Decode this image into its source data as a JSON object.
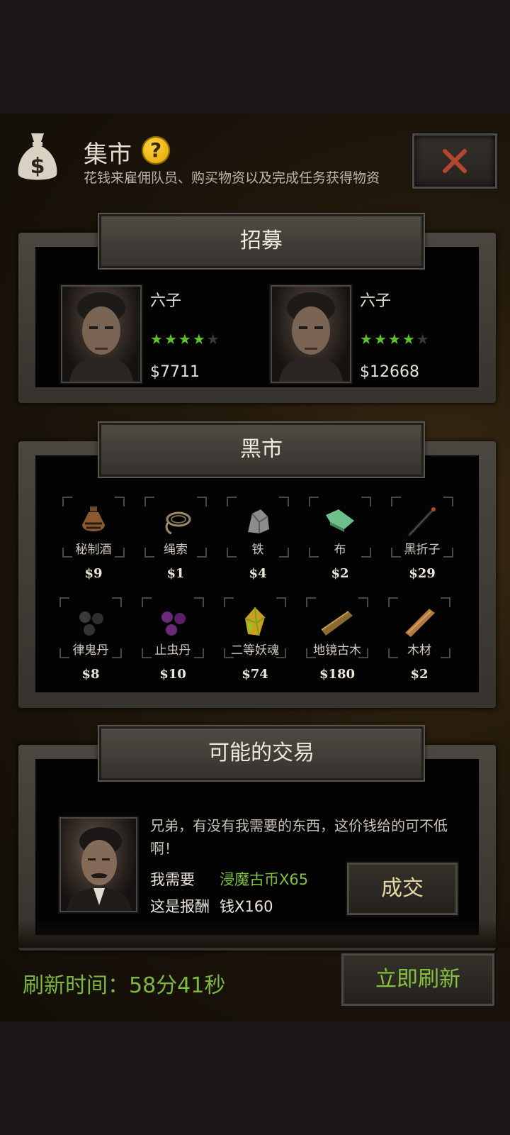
{
  "header": {
    "title": "集市",
    "help_icon_glyph": "?",
    "subtitle": "花钱来雇佣队员、购买物资以及完成任务获得物资",
    "close_icon": "close-x-icon",
    "close_color": "#b5462f"
  },
  "recruit": {
    "banner": "招募",
    "cards": [
      {
        "name": "六子",
        "stars": 4,
        "max_stars": 5,
        "price": "$7711"
      },
      {
        "name": "六子",
        "stars": 4,
        "max_stars": 5,
        "price": "$12668"
      }
    ]
  },
  "black_market": {
    "banner": "黑市",
    "items": [
      {
        "name": "秘制酒",
        "price": "$9",
        "icon": "wine-jug-icon"
      },
      {
        "name": "绳索",
        "price": "$1",
        "icon": "rope-icon"
      },
      {
        "name": "铁",
        "price": "$4",
        "icon": "iron-ore-icon"
      },
      {
        "name": "布",
        "price": "$2",
        "icon": "cloth-icon"
      },
      {
        "name": "黑折子",
        "price": "$29",
        "icon": "black-folding-stick-icon"
      },
      {
        "name": "律鬼丹",
        "price": "$8",
        "icon": "black-pills-icon"
      },
      {
        "name": "止虫丹",
        "price": "$10",
        "icon": "purple-pills-icon"
      },
      {
        "name": "二等妖魂",
        "price": "$74",
        "icon": "soul-crystal-icon"
      },
      {
        "name": "地镜古木",
        "price": "$180",
        "icon": "ancient-wood-icon"
      },
      {
        "name": "木材",
        "price": "$2",
        "icon": "wood-plank-icon"
      }
    ]
  },
  "trade": {
    "banner": "可能的交易",
    "message": "兄弟，有没有我需要的东西，这价钱给的可不低啊！",
    "need_label": "我需要",
    "need_value": "浸魔古币X65",
    "reward_label": "这是报酬",
    "reward_value": "钱X160",
    "deal_button": "成交"
  },
  "footer": {
    "refresh_time": "刷新时间：58分41秒",
    "refresh_button": "立即刷新"
  },
  "colors": {
    "accent_green": "#7cb83b",
    "star_green": "#5fc02a",
    "gold_text": "#e4d7a4"
  }
}
